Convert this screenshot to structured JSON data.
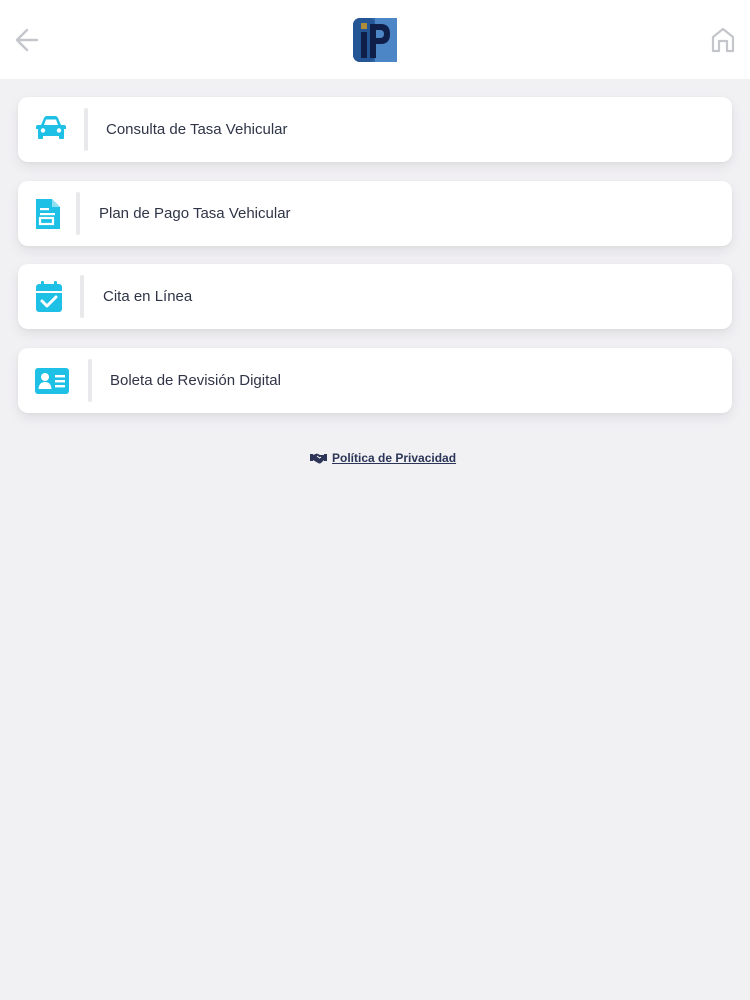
{
  "header": {
    "back_icon": "arrow-left-icon",
    "home_icon": "home-icon",
    "logo": "ip-logo"
  },
  "menu": {
    "accent_color": "#1ec0e6",
    "items": [
      {
        "label": "Consulta de Tasa Vehicular",
        "icon": "car-icon"
      },
      {
        "label": "Plan de Pago Tasa Vehicular",
        "icon": "document-icon"
      },
      {
        "label": "Cita en Línea",
        "icon": "calendar-check-icon"
      },
      {
        "label": "Boleta de Revisión Digital",
        "icon": "id-card-icon"
      }
    ]
  },
  "footer": {
    "privacy_label": "Política de Privacidad",
    "privacy_icon": "handshake-icon"
  }
}
